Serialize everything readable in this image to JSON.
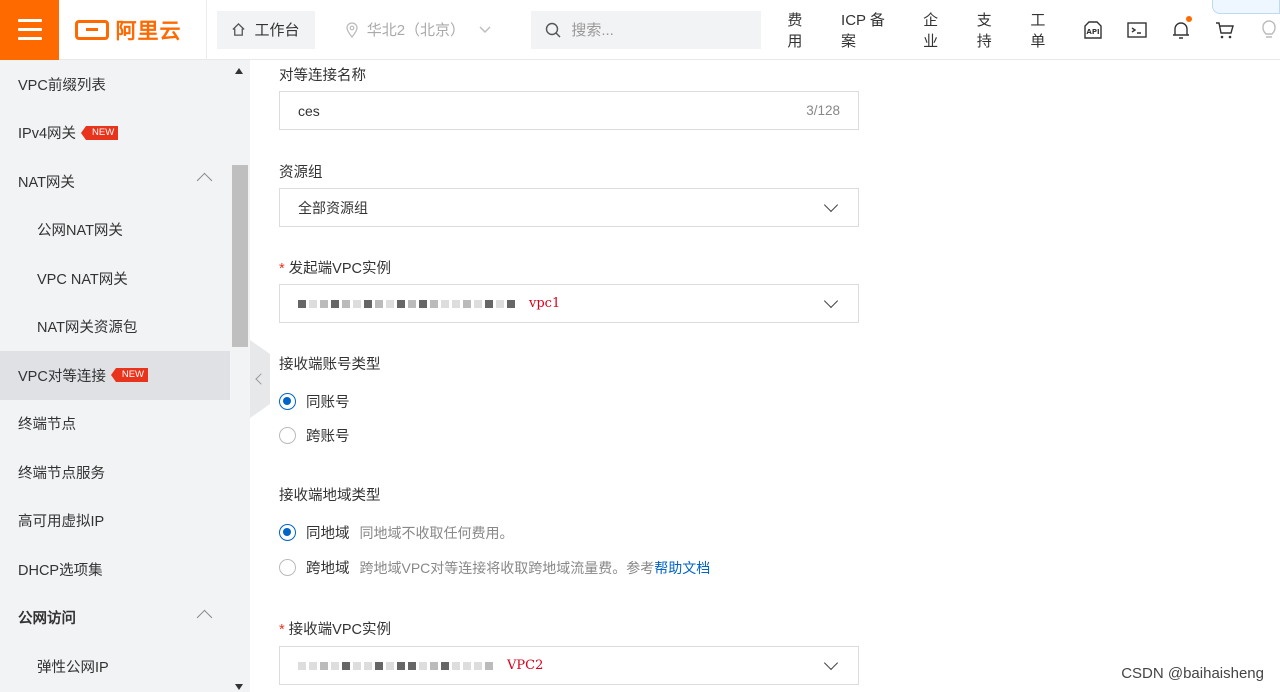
{
  "topbar": {
    "logo_text": "阿里云",
    "workbench_label": "工作台",
    "region_label": "华北2（北京）",
    "search_placeholder": "搜索...",
    "links": [
      "费用",
      "ICP 备案",
      "企业",
      "支持",
      "工单"
    ],
    "icons": [
      "api-icon",
      "terminal-icon",
      "bell-icon",
      "cart-icon",
      "lightbulb-icon"
    ],
    "accent_color": "#ff6a00"
  },
  "sidebar": {
    "items": [
      {
        "label": "VPC前缀列表",
        "level": 1
      },
      {
        "label": "IPv4网关",
        "level": 1,
        "badge": "NEW"
      },
      {
        "label": "NAT网关",
        "level": 1,
        "expanded": true
      },
      {
        "label": "公网NAT网关",
        "level": 2
      },
      {
        "label": "VPC NAT网关",
        "level": 2
      },
      {
        "label": "NAT网关资源包",
        "level": 2
      },
      {
        "label": "VPC对等连接",
        "level": 1,
        "badge": "NEW",
        "active": true
      },
      {
        "label": "终端节点",
        "level": 1
      },
      {
        "label": "终端节点服务",
        "level": 1
      },
      {
        "label": "高可用虚拟IP",
        "level": 1
      },
      {
        "label": "DHCP选项集",
        "level": 1
      },
      {
        "label": "公网访问",
        "level": 1,
        "bold": true,
        "expanded": true
      },
      {
        "label": "弹性公网IP",
        "level": 2
      }
    ]
  },
  "form": {
    "name": {
      "label": "对等连接名称",
      "value": "ces",
      "counter": "3/128"
    },
    "resource_group": {
      "label": "资源组",
      "value": "全部资源组"
    },
    "initiator_vpc": {
      "label": "发起端VPC实例",
      "required": "*",
      "note": "vpc1"
    },
    "receiver_account_type": {
      "label": "接收端账号类型",
      "options": [
        {
          "label": "同账号",
          "selected": true
        },
        {
          "label": "跨账号",
          "selected": false
        }
      ]
    },
    "receiver_region_type": {
      "label": "接收端地域类型",
      "options": [
        {
          "label": "同地域",
          "hint": "同地域不收取任何费用。",
          "selected": true
        },
        {
          "label": "跨地域",
          "hint": "跨地域VPC对等连接将收取跨地域流量费。参考",
          "link": "帮助文档",
          "selected": false
        }
      ]
    },
    "receiver_vpc": {
      "label": "接收端VPC实例",
      "required": "*",
      "note": "VPC2"
    }
  },
  "watermark": "CSDN @baihaisheng"
}
